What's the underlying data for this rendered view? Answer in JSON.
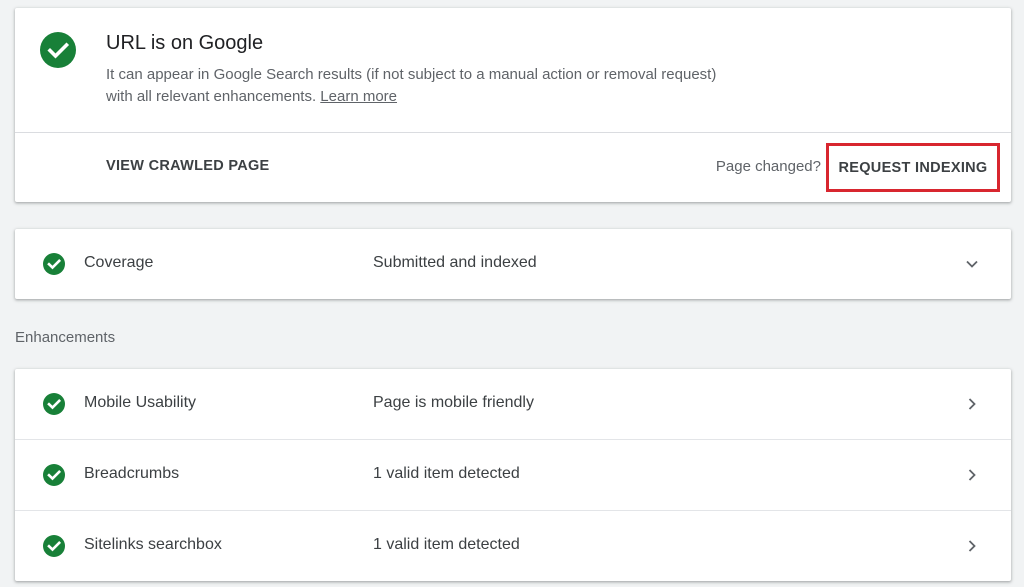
{
  "status": {
    "title": "URL is on Google",
    "description": "It can appear in Google Search results (if not subject to a manual action or removal request) with all relevant enhancements.",
    "learn_more": "Learn more",
    "view_crawled_label": "VIEW CRAWLED PAGE",
    "page_changed": "Page changed?",
    "request_indexing_label": "REQUEST INDEXING",
    "icon": "check-circle-icon",
    "accent_color": "#188038",
    "highlight_color": "#d8262f"
  },
  "coverage": {
    "label": "Coverage",
    "value": "Submitted and indexed",
    "icon": "check-circle-icon",
    "arrow_icon": "chevron-down-icon"
  },
  "enhancements": {
    "heading": "Enhancements",
    "items": [
      {
        "label": "Mobile Usability",
        "value": "Page is mobile friendly"
      },
      {
        "label": "Breadcrumbs",
        "value": "1 valid item detected"
      },
      {
        "label": "Sitelinks searchbox",
        "value": "1 valid item detected"
      }
    ],
    "arrow_icon": "chevron-right-icon"
  }
}
